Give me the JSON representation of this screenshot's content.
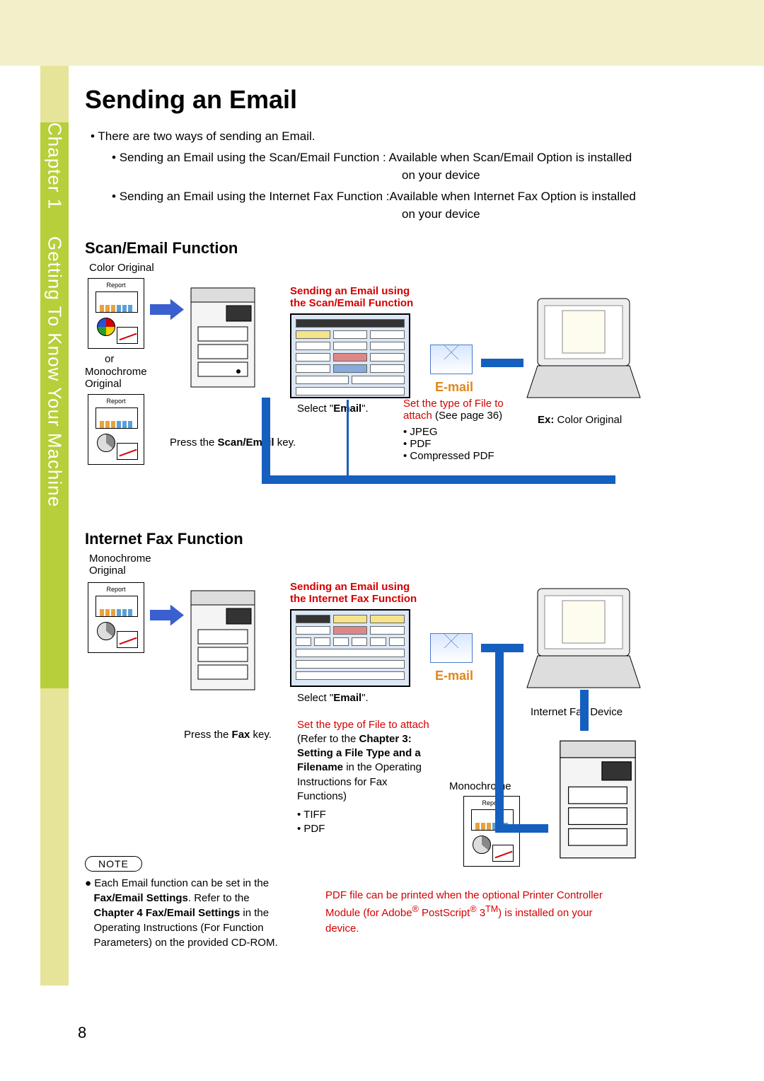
{
  "sidebar": {
    "chapter": "Chapter 1",
    "subtitle": "Getting To Know Your Machine"
  },
  "title": "Sending an Email",
  "intro": {
    "lead": "There are two ways of sending an Email.",
    "item1a": "Sending an Email using the Scan/Email Function : Available when Scan/Email Option is installed",
    "item1b": "on your device",
    "item2a": "Sending an Email using the Internet Fax Function :Available when Internet Fax Option is installed",
    "item2b": "on your device"
  },
  "scan": {
    "heading": "Scan/Email Function",
    "colorOriginal": "Color Original",
    "or": "or",
    "monoOriginal": "Monochrome Original",
    "pressKey_pre": "Press the ",
    "pressKey_bold": "Scan/Email",
    "pressKey_post": " key.",
    "redLine1": "Sending an Email using",
    "redLine2": "the Scan/Email Function",
    "select_pre": "Select \"",
    "select_bold": "Email",
    "select_post": "\".",
    "emailLabel": "E-mail",
    "setType1": "Set the type of File to",
    "setType2": "attach",
    "setType2b": " (See page 36)",
    "files": [
      "JPEG",
      "PDF",
      "Compressed PDF"
    ],
    "ex_pre": "Ex:",
    "ex_post": " Color Original",
    "reportTitle": "Report"
  },
  "ifax": {
    "heading": "Internet Fax Function",
    "monoOriginal": "Monochrome Original",
    "pressKey_pre": "Press the ",
    "pressKey_bold": "Fax",
    "pressKey_post": " key.",
    "redLine1": "Sending an Email using",
    "redLine2": "the Internet Fax Function",
    "select_pre": "Select \"",
    "select_bold": "Email",
    "select_post": "\".",
    "emailLabel": "E-mail",
    "setType": "Set the type of File to attach",
    "refer_pre": "(Refer to the ",
    "refer_bold1": "Chapter 3:",
    "refer_bold2": "Setting a File Type and a",
    "refer_bold3": "Filename",
    "refer_post1": " in the Operating",
    "refer_post2": "Instructions for Fax",
    "refer_post3": "Functions)",
    "files": [
      "TIFF",
      "PDF"
    ],
    "ifaxDevice": "Internet Fax Device",
    "monochrome": "Monochrome",
    "reportTitle": "Report"
  },
  "note": {
    "label": "NOTE",
    "line1": "Each Email function can be set in the",
    "line2_bold": "Fax/Email Settings",
    "line2_post": ". Refer to the",
    "line3_bold": "Chapter 4 Fax/Email Settings",
    "line3_post": " in the",
    "line4": "Operating Instructions (For Function",
    "line5": "Parameters) on the provided CD-ROM."
  },
  "pdfNote": {
    "line1": "PDF file can be printed when the optional Printer Controller",
    "line2a": "Module (for Adobe",
    "line2b": " PostScript",
    "line2c": " 3",
    "line2d": ") is installed on your",
    "line3": "device."
  },
  "pageNumber": "8"
}
